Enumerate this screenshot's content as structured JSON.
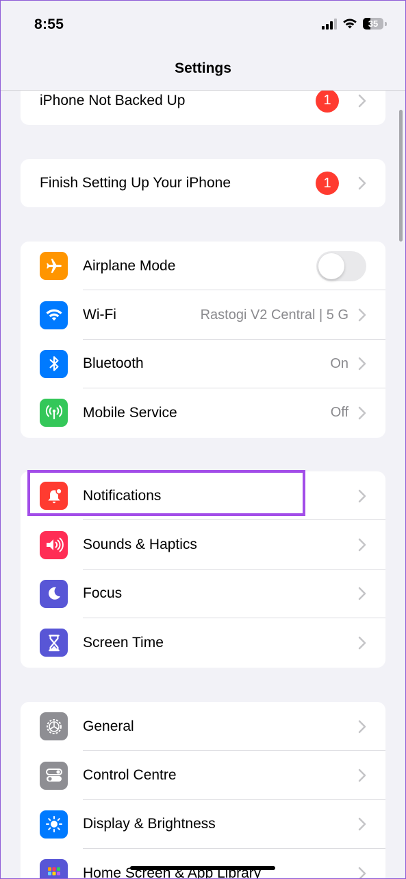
{
  "status_bar": {
    "time": "8:55",
    "battery_percent": "35",
    "battery_level": 0.35,
    "icons": [
      "signal-icon",
      "wifi-icon",
      "battery-icon"
    ]
  },
  "nav": {
    "title": "Settings"
  },
  "groups": {
    "backup": {
      "label": "iPhone Not Backed Up",
      "badge": "1"
    },
    "setup": {
      "label": "Finish Setting Up Your iPhone",
      "badge": "1"
    },
    "connectivity": [
      {
        "label": "Airplane Mode",
        "icon": "airplane-icon",
        "color": "#ff9500",
        "toggle_on": false
      },
      {
        "label": "Wi-Fi",
        "icon": "wifi-icon",
        "color": "#007aff",
        "value": "Rastogi V2 Central |  5 G"
      },
      {
        "label": "Bluetooth",
        "icon": "bluetooth-icon",
        "color": "#007aff",
        "value": "On"
      },
      {
        "label": "Mobile Service",
        "icon": "antenna-icon",
        "color": "#34c759",
        "value": "Off"
      }
    ],
    "alerts": [
      {
        "label": "Notifications",
        "icon": "bell-icon",
        "color": "#ff3b30"
      },
      {
        "label": "Sounds & Haptics",
        "icon": "speaker-icon",
        "color": "#ff2d55"
      },
      {
        "label": "Focus",
        "icon": "moon-icon",
        "color": "#5856d6"
      },
      {
        "label": "Screen Time",
        "icon": "hourglass-icon",
        "color": "#5856d6"
      }
    ],
    "general": [
      {
        "label": "General",
        "icon": "gear-icon",
        "color": "#8e8e93"
      },
      {
        "label": "Control Centre",
        "icon": "switches-icon",
        "color": "#8e8e93"
      },
      {
        "label": "Display & Brightness",
        "icon": "sun-icon",
        "color": "#007aff"
      },
      {
        "label": "Home Screen & App Library",
        "icon": "grid-icon",
        "color": "#5856d6"
      }
    ]
  },
  "colors": {
    "background": "#f2f2f7",
    "badge": "#ff3b30",
    "highlight": "#a24de8",
    "secondary_text": "#8a8a8e"
  }
}
